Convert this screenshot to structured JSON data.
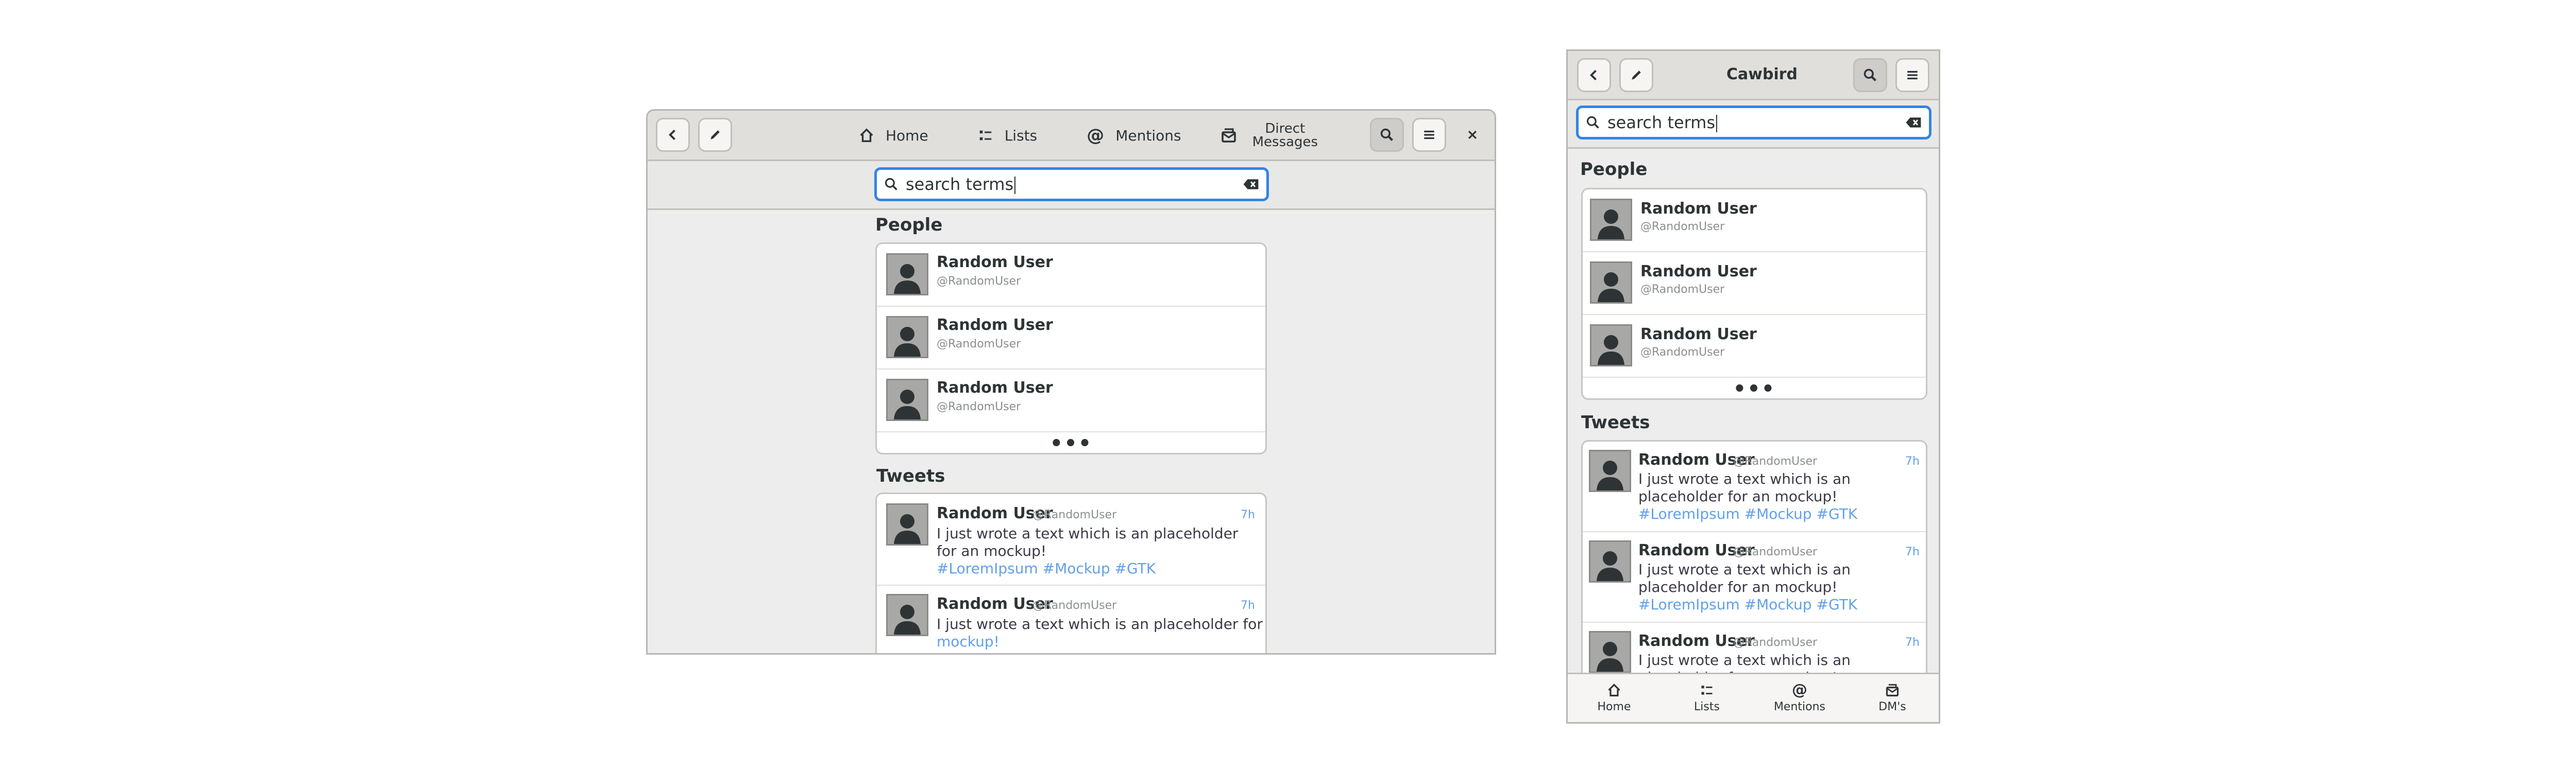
{
  "wide": {
    "nav": {
      "home": "Home",
      "lists": "Lists",
      "mentions": "Mentions",
      "dm_line1": "Direct",
      "dm_line2": "Messages"
    },
    "search": {
      "value": "search terms"
    },
    "people_title": "People",
    "people": [
      {
        "name": "Random User",
        "handle": "@RandomUser"
      },
      {
        "name": "Random User",
        "handle": "@RandomUser"
      },
      {
        "name": "Random User",
        "handle": "@RandomUser"
      }
    ],
    "tweets_title": "Tweets",
    "tweets": [
      {
        "name": "Random User",
        "handle": "@RandomUser",
        "time": "7h",
        "text": "I just wrote a text which is an placeholder for an mockup!",
        "tags": "#LoremIpsum #Mockup #GTK"
      },
      {
        "name": "Random User",
        "handle": "@RandomUser",
        "time": "7h",
        "text_line1": "I just wrote a text which is an placeholder for an",
        "text_link": "mockup!"
      }
    ]
  },
  "narrow": {
    "title": "Cawbird",
    "search": {
      "value": "search terms"
    },
    "people_title": "People",
    "people": [
      {
        "name": "Random User",
        "handle": "@RandomUser"
      },
      {
        "name": "Random User",
        "handle": "@RandomUser"
      },
      {
        "name": "Random User",
        "handle": "@RandomUser"
      }
    ],
    "tweets_title": "Tweets",
    "tweets": [
      {
        "name": "Random User",
        "handle": "@RandomUser",
        "time": "7h",
        "text": "I just wrote a text which is an placeholder for an mockup!",
        "tags": "#LoremIpsum #Mockup #GTK"
      },
      {
        "name": "Random User",
        "handle": "@RandomUser",
        "time": "7h",
        "text": "I just wrote a text which is an placeholder for an mockup!",
        "tags": "#LoremIpsum #Mockup #GTK"
      },
      {
        "name": "Random User",
        "handle": "@RandomUser",
        "time": "7h",
        "text": "I just wrote a text which is an placeholder for an mockup!"
      }
    ],
    "bottom_nav": {
      "home": "Home",
      "lists": "Lists",
      "mentions": "Mentions",
      "dms": "DM's"
    }
  },
  "colors": {
    "accent": "#3584e4",
    "link": "#62a0ea",
    "headerbar": "#e0dfdc"
  },
  "icons": [
    "back-icon",
    "edit-icon",
    "home-icon",
    "lists-icon",
    "mentions-icon",
    "direct-messages-icon",
    "search-icon",
    "menu-icon",
    "close-icon",
    "clear-icon",
    "avatar-icon",
    "more-icon"
  ]
}
